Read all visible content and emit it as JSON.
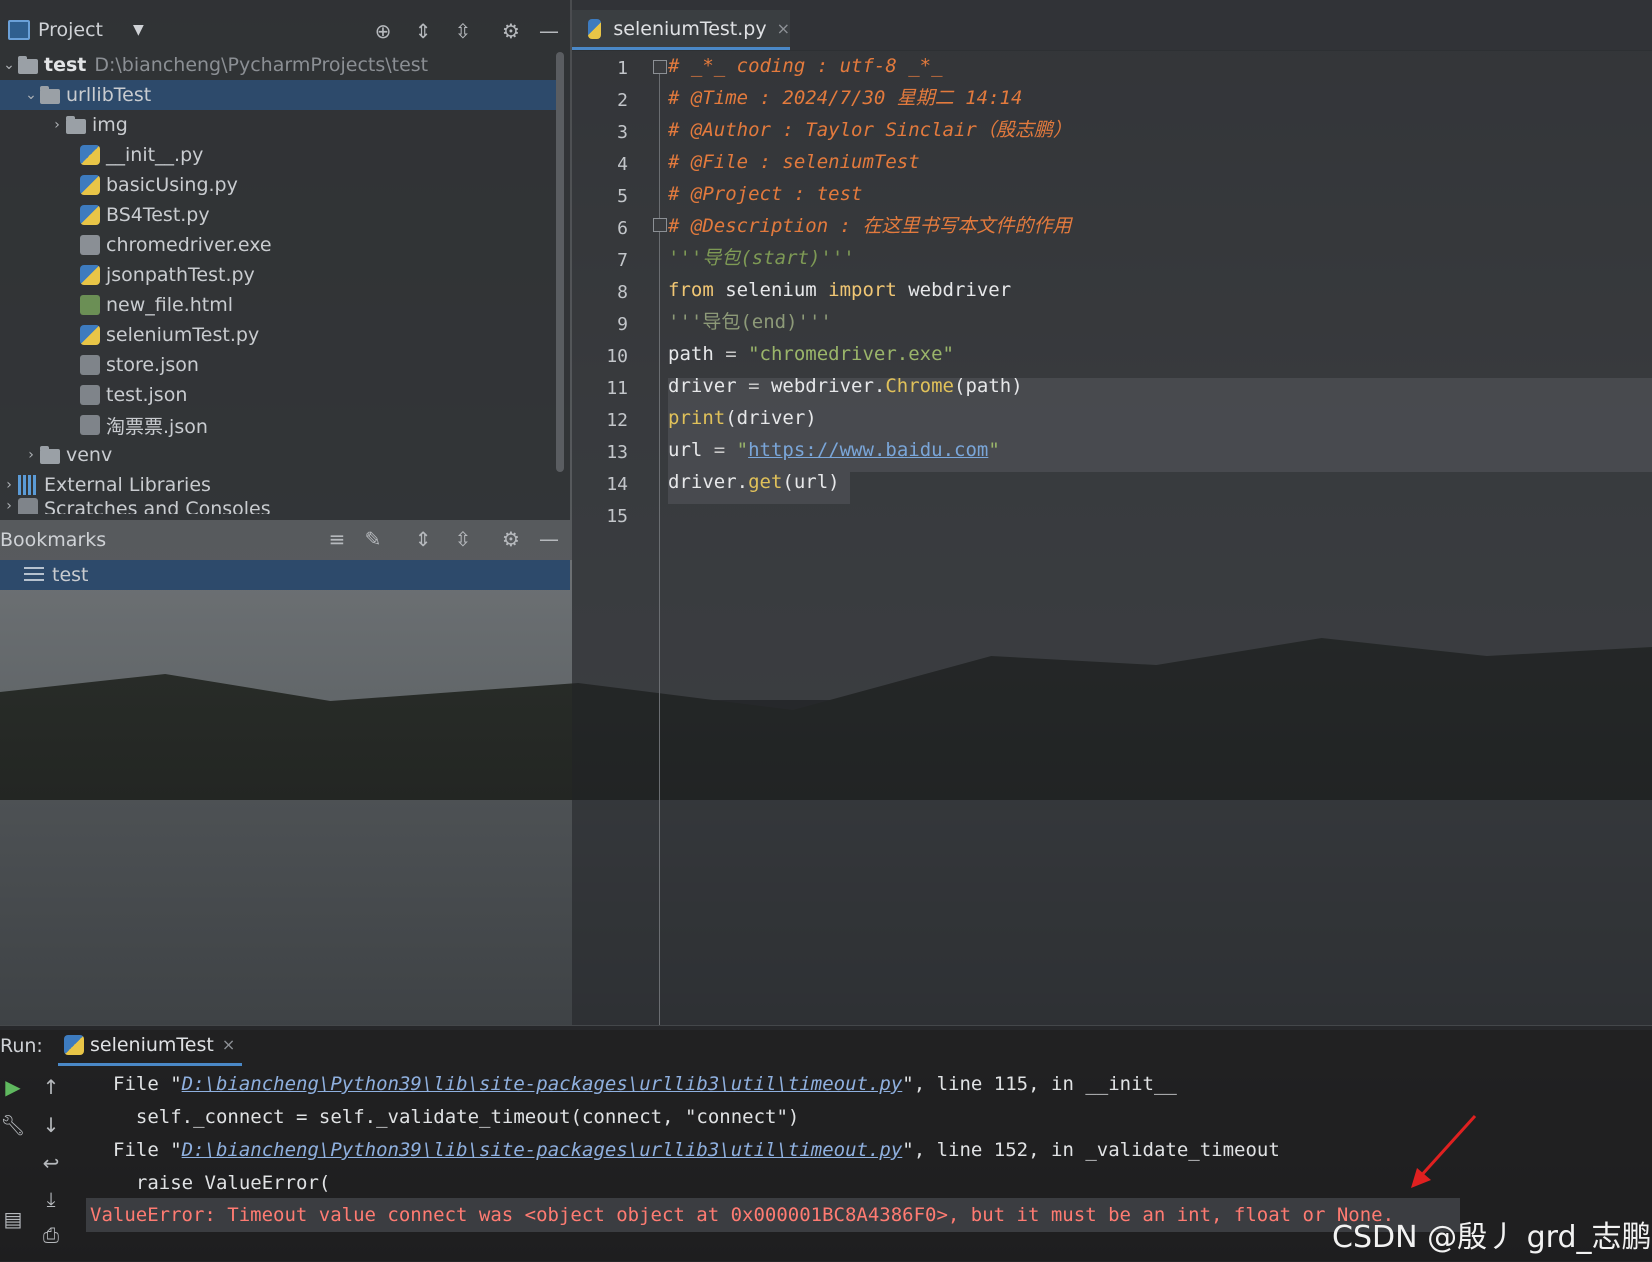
{
  "project_panel": {
    "title": "Project",
    "tree": [
      {
        "label": "test",
        "hint": "D:\\biancheng\\PycharmProjects\\test",
        "kind": "folder",
        "expanded": true
      },
      {
        "label": "urllibTest",
        "kind": "folder",
        "expanded": true,
        "selected": true
      },
      {
        "label": "img",
        "kind": "folder",
        "expanded": false
      },
      {
        "label": "__init__.py",
        "kind": "py"
      },
      {
        "label": "basicUsing.py",
        "kind": "py"
      },
      {
        "label": "BS4Test.py",
        "kind": "py"
      },
      {
        "label": "chromedriver.exe",
        "kind": "exe"
      },
      {
        "label": "jsonpathTest.py",
        "kind": "py"
      },
      {
        "label": "new_file.html",
        "kind": "html"
      },
      {
        "label": "seleniumTest.py",
        "kind": "py"
      },
      {
        "label": "store.json",
        "kind": "json"
      },
      {
        "label": "test.json",
        "kind": "json"
      },
      {
        "label": "淘票票.json",
        "kind": "json"
      },
      {
        "label": "venv",
        "kind": "folder",
        "expanded": false
      },
      {
        "label": "External Libraries",
        "kind": "lib",
        "expanded": false
      },
      {
        "label": "Scratches and Consoles",
        "kind": "scratch",
        "expanded": false
      }
    ]
  },
  "bookmarks": {
    "title": "Bookmarks",
    "items": [
      "test"
    ]
  },
  "editor": {
    "tab_label": "seleniumTest.py",
    "line_numbers": [
      "1",
      "2",
      "3",
      "4",
      "5",
      "6",
      "7",
      "8",
      "9",
      "10",
      "11",
      "12",
      "13",
      "14",
      "15"
    ],
    "lines": {
      "l1": "# _*_ coding : utf-8 _*_",
      "l2": "# @Time : 2024/7/30 星期二 14:14",
      "l3": "# @Author : Taylor Sinclair（殷志鹏）",
      "l4": "# @File : seleniumTest",
      "l5": "# @Project : test",
      "l6": "# @Description : 在这里书写本文件的作用",
      "l7": "'''导包(start)'''",
      "l8": {
        "kw1": "from",
        "mod": " selenium ",
        "kw2": "import",
        "name": " webdriver"
      },
      "l9": "'''导包(end)'''",
      "l10": {
        "var": "path",
        "op": " = ",
        "str": "\"chromedriver.exe\""
      },
      "l11": {
        "var": "driver",
        "op": " = ",
        "obj": "webdriver.",
        "fn": "Chrome",
        "args": "(path)"
      },
      "l12": {
        "fn": "print",
        "args": "(driver)"
      },
      "l13": {
        "var": "url",
        "op": " = ",
        "q1": "\"",
        "url": "https://www.baidu.com",
        "q2": "\""
      },
      "l14": {
        "obj": "driver.",
        "fn": "get",
        "args": "(url)"
      }
    }
  },
  "run_panel": {
    "label": "Run:",
    "tab_label": "seleniumTest",
    "output": {
      "o1": {
        "pre": "File \"",
        "path": "D:\\biancheng\\Python39\\lib\\site-packages\\urllib3\\util\\timeout.py",
        "post": "\", line 115, in __init__"
      },
      "o2": "  self._connect = self._validate_timeout(connect, \"connect\")",
      "o3": {
        "pre": "File \"",
        "path": "D:\\biancheng\\Python39\\lib\\site-packages\\urllib3\\util\\timeout.py",
        "post": "\", line 152, in _validate_timeout"
      },
      "o4": "  raise ValueError(",
      "error": "ValueError: Timeout value connect was <object object at 0x000001BC8A4386F0>, but it must be an int, float or None."
    }
  },
  "watermark": "CSDN @殷丿 grd_志鹏",
  "colors": {
    "selection": "#2d4a6b",
    "comment": "#e37a3d",
    "keyword": "#f0c674",
    "string": "#9ab56a",
    "error": "#ff7b72",
    "arrow": "#e02020"
  }
}
